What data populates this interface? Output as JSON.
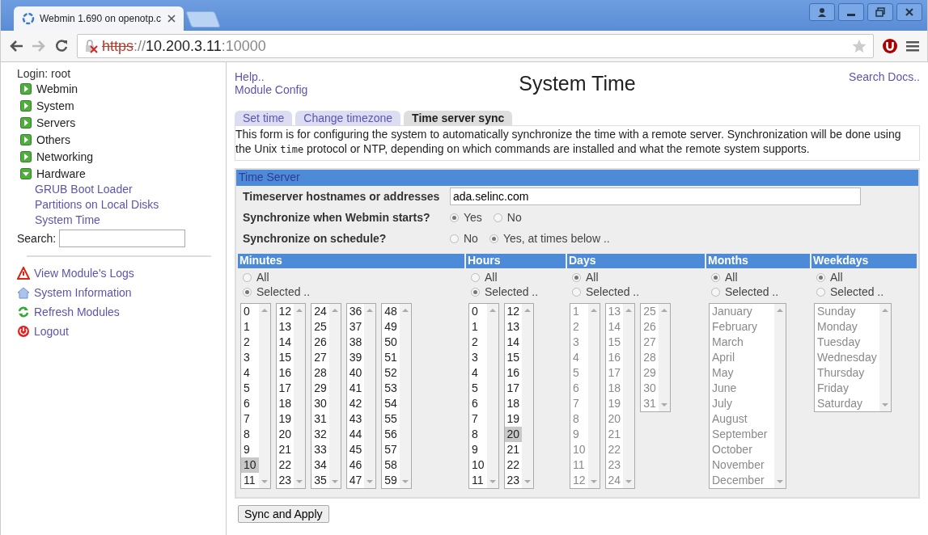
{
  "browser": {
    "tab_title": "Webmin 1.690 on openotp.c",
    "url": {
      "scheme": "https",
      "scheme_insecure": true,
      "separator": "://",
      "host": "10.200.3.11",
      "port": ":10000"
    }
  },
  "sidebar": {
    "login": "Login: root",
    "categories": [
      {
        "label": "Webmin",
        "expanded": false
      },
      {
        "label": "System",
        "expanded": false
      },
      {
        "label": "Servers",
        "expanded": false
      },
      {
        "label": "Others",
        "expanded": false
      },
      {
        "label": "Networking",
        "expanded": false
      },
      {
        "label": "Hardware",
        "expanded": true,
        "children": [
          "GRUB Boot Loader",
          "Partitions on Local Disks",
          "System Time"
        ]
      }
    ],
    "search_label": "Search:",
    "links": [
      {
        "label": "View Module's Logs",
        "kind": "logs"
      },
      {
        "label": "System Information",
        "kind": "info"
      },
      {
        "label": "Refresh Modules",
        "kind": "refresh"
      },
      {
        "label": "Logout",
        "kind": "logout"
      }
    ]
  },
  "header": {
    "links": [
      "Help..",
      "Module Config"
    ],
    "title": "System Time",
    "search_docs": "Search Docs.."
  },
  "tabs": [
    {
      "label": "Set time",
      "selected": false
    },
    {
      "label": "Change timezone",
      "selected": false
    },
    {
      "label": "Time server sync",
      "selected": true
    }
  ],
  "description": {
    "before": "This form is for configuring the system to automatically synchronize the time with a remote server. Synchronization will be done using the Unix ",
    "code": "time",
    "after": " protocol or NTP, depending on which commands are installed and what the remote system supports."
  },
  "form": {
    "title": "Time Server",
    "hostnames": {
      "label": "Timeserver hostnames or addresses",
      "value": "ada.selinc.com"
    },
    "radio_rows": [
      {
        "label": "Synchronize when Webmin starts?",
        "options": [
          {
            "label": "Yes",
            "selected": true
          },
          {
            "label": "No",
            "selected": false
          }
        ]
      },
      {
        "label": "Synchronize on schedule?",
        "options": [
          {
            "label": "No",
            "selected": false
          },
          {
            "label": "Yes, at times below ..",
            "selected": true
          }
        ]
      }
    ],
    "schedule": [
      {
        "header": "Minutes",
        "options": [
          {
            "label": "All",
            "selected": false
          },
          {
            "label": "Selected ..",
            "selected": true
          }
        ],
        "disabled": false,
        "lists": [
          {
            "items": [
              {
                "text": "0",
                "selected": false
              },
              {
                "text": "1",
                "selected": false
              },
              {
                "text": "2",
                "selected": false
              },
              {
                "text": "3",
                "selected": false
              },
              {
                "text": "4",
                "selected": false
              },
              {
                "text": "5",
                "selected": false
              },
              {
                "text": "6",
                "selected": false
              },
              {
                "text": "7",
                "selected": false
              },
              {
                "text": "8",
                "selected": false
              },
              {
                "text": "9",
                "selected": false
              },
              {
                "text": "10",
                "selected": true
              },
              {
                "text": "11",
                "selected": false
              }
            ]
          },
          {
            "items": [
              {
                "text": "12",
                "selected": false
              },
              {
                "text": "13",
                "selected": false
              },
              {
                "text": "14",
                "selected": false
              },
              {
                "text": "15",
                "selected": false
              },
              {
                "text": "16",
                "selected": false
              },
              {
                "text": "17",
                "selected": false
              },
              {
                "text": "18",
                "selected": false
              },
              {
                "text": "19",
                "selected": false
              },
              {
                "text": "20",
                "selected": false
              },
              {
                "text": "21",
                "selected": false
              },
              {
                "text": "22",
                "selected": false
              },
              {
                "text": "23",
                "selected": false
              }
            ]
          },
          {
            "items": [
              {
                "text": "24",
                "selected": false
              },
              {
                "text": "25",
                "selected": false
              },
              {
                "text": "26",
                "selected": false
              },
              {
                "text": "27",
                "selected": false
              },
              {
                "text": "28",
                "selected": false
              },
              {
                "text": "29",
                "selected": false
              },
              {
                "text": "30",
                "selected": false
              },
              {
                "text": "31",
                "selected": false
              },
              {
                "text": "32",
                "selected": false
              },
              {
                "text": "33",
                "selected": false
              },
              {
                "text": "34",
                "selected": false
              },
              {
                "text": "35",
                "selected": false
              }
            ]
          },
          {
            "items": [
              {
                "text": "36",
                "selected": false
              },
              {
                "text": "37",
                "selected": false
              },
              {
                "text": "38",
                "selected": false
              },
              {
                "text": "39",
                "selected": false
              },
              {
                "text": "40",
                "selected": false
              },
              {
                "text": "41",
                "selected": false
              },
              {
                "text": "42",
                "selected": false
              },
              {
                "text": "43",
                "selected": false
              },
              {
                "text": "44",
                "selected": false
              },
              {
                "text": "45",
                "selected": false
              },
              {
                "text": "46",
                "selected": false
              },
              {
                "text": "47",
                "selected": false
              }
            ]
          },
          {
            "items": [
              {
                "text": "48",
                "selected": false
              },
              {
                "text": "49",
                "selected": false
              },
              {
                "text": "50",
                "selected": false
              },
              {
                "text": "51",
                "selected": false
              },
              {
                "text": "52",
                "selected": false
              },
              {
                "text": "53",
                "selected": false
              },
              {
                "text": "54",
                "selected": false
              },
              {
                "text": "55",
                "selected": false
              },
              {
                "text": "56",
                "selected": false
              },
              {
                "text": "57",
                "selected": false
              },
              {
                "text": "58",
                "selected": false
              },
              {
                "text": "59",
                "selected": false
              }
            ]
          }
        ]
      },
      {
        "header": "Hours",
        "options": [
          {
            "label": "All",
            "selected": false
          },
          {
            "label": "Selected ..",
            "selected": true
          }
        ],
        "disabled": false,
        "lists": [
          {
            "items": [
              {
                "text": "0",
                "selected": false
              },
              {
                "text": "1",
                "selected": false
              },
              {
                "text": "2",
                "selected": false
              },
              {
                "text": "3",
                "selected": false
              },
              {
                "text": "4",
                "selected": false
              },
              {
                "text": "5",
                "selected": false
              },
              {
                "text": "6",
                "selected": false
              },
              {
                "text": "7",
                "selected": false
              },
              {
                "text": "8",
                "selected": false
              },
              {
                "text": "9",
                "selected": false
              },
              {
                "text": "10",
                "selected": false
              },
              {
                "text": "11",
                "selected": false
              }
            ]
          },
          {
            "items": [
              {
                "text": "12",
                "selected": false
              },
              {
                "text": "13",
                "selected": false
              },
              {
                "text": "14",
                "selected": false
              },
              {
                "text": "15",
                "selected": false
              },
              {
                "text": "16",
                "selected": false
              },
              {
                "text": "17",
                "selected": false
              },
              {
                "text": "18",
                "selected": false
              },
              {
                "text": "19",
                "selected": false
              },
              {
                "text": "20",
                "selected": true
              },
              {
                "text": "21",
                "selected": false
              },
              {
                "text": "22",
                "selected": false
              },
              {
                "text": "23",
                "selected": false
              }
            ]
          }
        ]
      },
      {
        "header": "Days",
        "options": [
          {
            "label": "All",
            "selected": true
          },
          {
            "label": "Selected ..",
            "selected": false
          }
        ],
        "disabled": true,
        "lists": [
          {
            "items": [
              {
                "text": "1",
                "selected": false
              },
              {
                "text": "2",
                "selected": false
              },
              {
                "text": "3",
                "selected": false
              },
              {
                "text": "4",
                "selected": false
              },
              {
                "text": "5",
                "selected": false
              },
              {
                "text": "6",
                "selected": false
              },
              {
                "text": "7",
                "selected": false
              },
              {
                "text": "8",
                "selected": false
              },
              {
                "text": "9",
                "selected": false
              },
              {
                "text": "10",
                "selected": false
              },
              {
                "text": "11",
                "selected": false
              },
              {
                "text": "12",
                "selected": false
              }
            ]
          },
          {
            "items": [
              {
                "text": "13",
                "selected": false
              },
              {
                "text": "14",
                "selected": false
              },
              {
                "text": "15",
                "selected": false
              },
              {
                "text": "16",
                "selected": false
              },
              {
                "text": "17",
                "selected": false
              },
              {
                "text": "18",
                "selected": false
              },
              {
                "text": "19",
                "selected": false
              },
              {
                "text": "20",
                "selected": false
              },
              {
                "text": "21",
                "selected": false
              },
              {
                "text": "22",
                "selected": false
              },
              {
                "text": "23",
                "selected": false
              },
              {
                "text": "24",
                "selected": false
              }
            ]
          },
          {
            "items": [
              {
                "text": "25",
                "selected": false
              },
              {
                "text": "26",
                "selected": false
              },
              {
                "text": "27",
                "selected": false
              },
              {
                "text": "28",
                "selected": false
              },
              {
                "text": "29",
                "selected": false
              },
              {
                "text": "30",
                "selected": false
              },
              {
                "text": "31",
                "selected": false
              }
            ]
          }
        ]
      },
      {
        "header": "Months",
        "options": [
          {
            "label": "All",
            "selected": true
          },
          {
            "label": "Selected ..",
            "selected": false
          }
        ],
        "disabled": true,
        "lists": [
          {
            "items": [
              {
                "text": "January",
                "selected": false
              },
              {
                "text": "February",
                "selected": false
              },
              {
                "text": "March",
                "selected": false
              },
              {
                "text": "April",
                "selected": false
              },
              {
                "text": "May",
                "selected": false
              },
              {
                "text": "June",
                "selected": false
              },
              {
                "text": "July",
                "selected": false
              },
              {
                "text": "August",
                "selected": false
              },
              {
                "text": "September",
                "selected": false
              },
              {
                "text": "October",
                "selected": false
              },
              {
                "text": "November",
                "selected": false
              },
              {
                "text": "December",
                "selected": false
              }
            ]
          }
        ]
      },
      {
        "header": "Weekdays",
        "options": [
          {
            "label": "All",
            "selected": true
          },
          {
            "label": "Selected ..",
            "selected": false
          }
        ],
        "disabled": true,
        "lists": [
          {
            "items": [
              {
                "text": "Sunday",
                "selected": false
              },
              {
                "text": "Monday",
                "selected": false
              },
              {
                "text": "Tuesday",
                "selected": false
              },
              {
                "text": "Wednesday",
                "selected": false
              },
              {
                "text": "Thursday",
                "selected": false
              },
              {
                "text": "Friday",
                "selected": false
              },
              {
                "text": "Saturday",
                "selected": false
              }
            ]
          }
        ]
      }
    ]
  },
  "button": "Sync and Apply"
}
